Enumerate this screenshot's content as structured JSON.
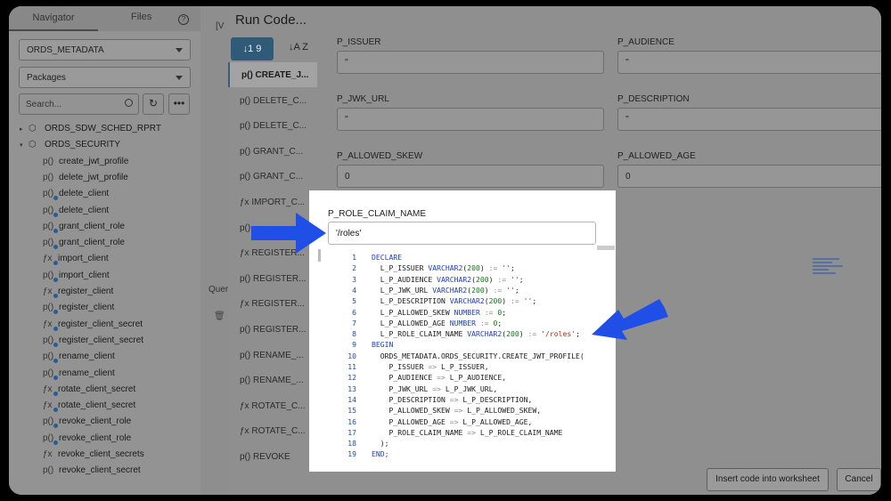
{
  "navigator": {
    "tab_navigator": "Navigator",
    "tab_files": "Files",
    "help": "?",
    "schema_select": "ORDS_METADATA",
    "type_select": "Packages",
    "search_placeholder": "Search...",
    "tree": [
      {
        "icon": "▸",
        "label": "ORDS_SDW_SCHED_RPRT",
        "kind": "package"
      },
      {
        "icon": "▾",
        "label": "ORDS_SECURITY",
        "kind": "package"
      },
      {
        "label": "create_jwt_profile",
        "kind": "procedure"
      },
      {
        "label": "delete_jwt_profile",
        "kind": "procedure"
      },
      {
        "label": "delete_client",
        "kind": "procedure-overload"
      },
      {
        "label": "delete_client",
        "kind": "procedure-overload"
      },
      {
        "label": "grant_client_role",
        "kind": "procedure-overload"
      },
      {
        "label": "grant_client_role",
        "kind": "procedure-overload"
      },
      {
        "label": "import_client",
        "kind": "function-overload"
      },
      {
        "label": "import_client",
        "kind": "procedure-overload"
      },
      {
        "label": "register_client",
        "kind": "function-overload"
      },
      {
        "label": "register_client",
        "kind": "procedure-overload"
      },
      {
        "label": "register_client_secret",
        "kind": "function-overload"
      },
      {
        "label": "register_client_secret",
        "kind": "procedure-overload"
      },
      {
        "label": "rename_client",
        "kind": "procedure-overload"
      },
      {
        "label": "rename_client",
        "kind": "procedure-overload"
      },
      {
        "label": "rotate_client_secret",
        "kind": "function-overload"
      },
      {
        "label": "rotate_client_secret",
        "kind": "function-overload"
      },
      {
        "label": "revoke_client_role",
        "kind": "procedure-overload"
      },
      {
        "label": "revoke_client_role",
        "kind": "procedure-overload"
      },
      {
        "label": "revoke_client_secrets",
        "kind": "function"
      },
      {
        "label": "revoke_client_secret",
        "kind": "procedure"
      }
    ]
  },
  "middle": {
    "badge": "[V",
    "tab": "Quer",
    "trash": "🗑"
  },
  "dialog": {
    "title": "Run Code...",
    "sort_button": "↓1 9",
    "sort_alpha": "↓A Z",
    "procs": [
      {
        "prefix": "p()",
        "label": "CREATE_J..."
      },
      {
        "prefix": "p()",
        "label": "DELETE_C..."
      },
      {
        "prefix": "p()",
        "label": "DELETE_C..."
      },
      {
        "prefix": "p()",
        "label": "GRANT_C..."
      },
      {
        "prefix": "p()",
        "label": "GRANT_C..."
      },
      {
        "prefix": "fx",
        "label": "IMPORT_C..."
      },
      {
        "prefix": "p()",
        "label": ""
      },
      {
        "prefix": "fx",
        "label": "REGISTER..."
      },
      {
        "prefix": "p()",
        "label": "REGISTER..."
      },
      {
        "prefix": "fx",
        "label": "REGISTER..."
      },
      {
        "prefix": "p()",
        "label": "REGISTER..."
      },
      {
        "prefix": "p()",
        "label": "RENAME_..."
      },
      {
        "prefix": "p()",
        "label": "RENAME_..."
      },
      {
        "prefix": "fx",
        "label": "ROTATE_C..."
      },
      {
        "prefix": "fx",
        "label": "ROTATE_C..."
      },
      {
        "prefix": "p()",
        "label": "REVOKE"
      }
    ],
    "fields": {
      "p_issuer": {
        "label": "P_ISSUER",
        "value": "''"
      },
      "p_audience": {
        "label": "P_AUDIENCE",
        "value": "''"
      },
      "p_jwk_url": {
        "label": "P_JWK_URL",
        "value": "''"
      },
      "p_description": {
        "label": "P_DESCRIPTION",
        "value": "''"
      },
      "p_allowed_skew": {
        "label": "P_ALLOWED_SKEW",
        "value": "0"
      },
      "p_allowed_age": {
        "label": "P_ALLOWED_AGE",
        "value": "0"
      },
      "p_role_claim_name": {
        "label": "P_ROLE_CLAIM_NAME",
        "value": "'/roles'"
      }
    },
    "insert_button": "Insert code into worksheet",
    "cancel_button": "Cancel"
  },
  "code": {
    "lines": [
      "1",
      "2",
      "3",
      "4",
      "5",
      "6",
      "7",
      "8",
      "9",
      "10",
      "11",
      "12",
      "13",
      "14",
      "15",
      "16",
      "17",
      "18",
      "19"
    ],
    "tokens": {
      "declare": "DECLARE",
      "begin": "BEGIN",
      "end": "END;",
      "l_p_issuer": "L_P_ISSUER",
      "l_p_audience": "L_P_AUDIENCE",
      "l_p_jwk_url": "L_P_JWK_URL",
      "l_p_description": "L_P_DESCRIPTION",
      "l_p_allowed_skew": "L_P_ALLOWED_SKEW",
      "l_p_allowed_age": "L_P_ALLOWED_AGE",
      "l_p_role_claim_name": "L_P_ROLE_CLAIM_NAME",
      "varchar": "VARCHAR2",
      "number": "NUMBER",
      "size": "200",
      "assign": ":=",
      "empty_str": "''",
      "zero": "0",
      "roles_str": "'/roles'",
      "call": "ORDS_METADATA.ORDS_SECURITY.CREATE_JWT_PROFILE(",
      "arrow": "=>",
      "a_issuer": "P_ISSUER",
      "a_audience": "P_AUDIENCE",
      "a_jwk_url": "P_JWK_URL",
      "a_description": "P_DESCRIPTION",
      "a_allowed_skew": "P_ALLOWED_SKEW",
      "a_allowed_age": "P_ALLOWED_AGE",
      "a_role_claim_name": "P_ROLE_CLAIM_NAME",
      "close": ");"
    }
  },
  "colors": {
    "arrow": "#1f4fe6",
    "keyword": "#1f3fbf",
    "string": "#c02010",
    "number": "#117711"
  }
}
